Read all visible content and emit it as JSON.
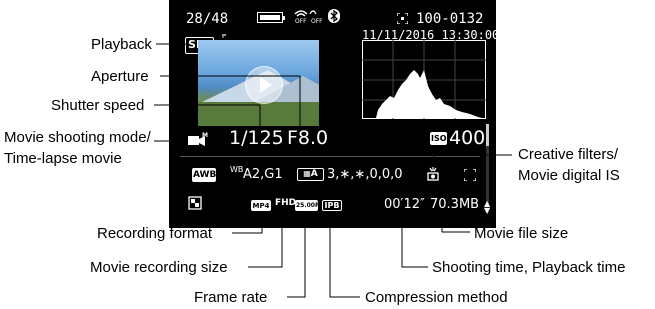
{
  "screen": {
    "frame_counter": "28/48",
    "folder_file": "100-0132",
    "datetime": "11/11/2016 13:30:00",
    "set_label": "SET",
    "shutter_speed": "1/125",
    "aperture": "F8.0",
    "iso_label": "ISO",
    "iso_value": "400",
    "awb_label": "AWB",
    "wb_shift_label": "WB",
    "wb_shift_value": "A2,G1",
    "picture_style_value": "3,∗,∗,0,0,0",
    "picture_style_code": "A",
    "format_label": "MP4",
    "size_label": "FHD",
    "frame_rate_label": "25.00P",
    "compression_label": "IPB",
    "playback_time": "00′12″",
    "file_size": "70.3MB"
  },
  "annotations": {
    "playback": "Playback",
    "aperture": "Aperture",
    "shutter_speed": "Shutter speed",
    "movie_mode_line1": "Movie shooting mode/",
    "movie_mode_line2": "Time-lapse movie",
    "creative_line1": "Creative filters/",
    "creative_line2": "Movie digital IS",
    "recording_format": "Recording format",
    "movie_file_size": "Movie file size",
    "movie_recording_size": "Movie recording size",
    "shooting_time": "Shooting time, Playback time",
    "frame_rate": "Frame rate",
    "compression_method": "Compression method"
  },
  "icons": [
    "battery-icon",
    "wifi-icon",
    "bluetooth-icon",
    "movie-camera-icon",
    "af-point-icon",
    "creative-filter-icon",
    "aspect-ratio-icon",
    "scroll-arrows-icon"
  ],
  "colors": {
    "screen_bg": "#000000",
    "screen_text": "#ffffff",
    "label_text": "#000000"
  }
}
